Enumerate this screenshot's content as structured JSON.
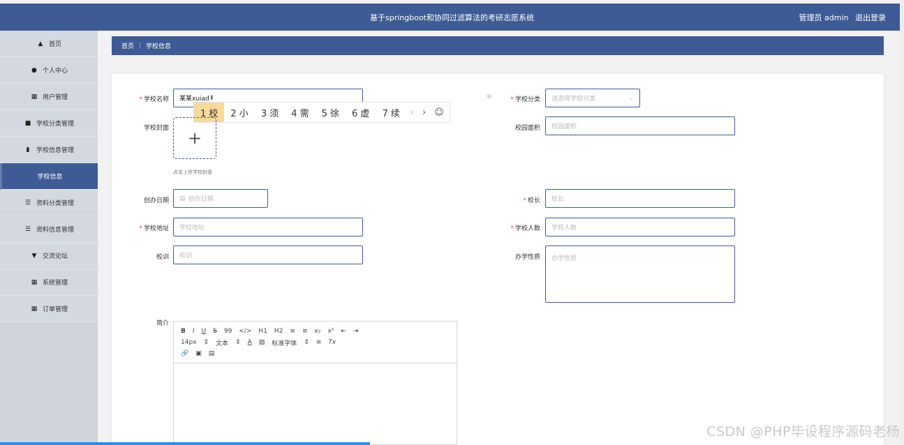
{
  "header": {
    "title": "基于springboot和协同过滤算法的考研志愿系统",
    "user": "管理员 admin",
    "logout": "退出登录"
  },
  "sidebar": {
    "items": [
      {
        "label": "首页",
        "icon": "home-icon"
      },
      {
        "label": "个人中心",
        "icon": "user-icon"
      },
      {
        "label": "用户管理",
        "icon": "grid-icon"
      },
      {
        "label": "学校分类管理",
        "icon": "ticket-icon"
      },
      {
        "label": "学校信息管理",
        "icon": "file-icon"
      },
      {
        "label": "学校信息",
        "icon": ""
      },
      {
        "label": "资料分类管理",
        "icon": "list-icon"
      },
      {
        "label": "资料信息管理",
        "icon": "list-icon"
      },
      {
        "label": "交流论坛",
        "icon": "forum-icon"
      },
      {
        "label": "系统管理",
        "icon": "grid-icon"
      },
      {
        "label": "订单管理",
        "icon": "grid-icon"
      }
    ]
  },
  "breadcrumb": {
    "home": "首页",
    "sep": "⋮",
    "current": "学校信息"
  },
  "form": {
    "name_label": "学校名称",
    "name_value": "某某xuiad",
    "category_label": "学校分类",
    "category_placeholder": "请选择学校分类",
    "cover_label": "学校封面",
    "cover_hint": "点击上传学校封面",
    "area_label": "校园面积",
    "area_placeholder": "校园面积",
    "founded_label": "创办日期",
    "founded_placeholder": "创办日期",
    "president_label": "校长",
    "president_placeholder": "校长",
    "address_label": "学校地址",
    "address_placeholder": "学校地址",
    "students_label": "学校人数",
    "students_placeholder": "学校人数",
    "motto_label": "校训",
    "motto_placeholder": "校训",
    "nature_label": "办学性质",
    "nature_placeholder": "办学性质",
    "intro_label": "简介"
  },
  "ime": {
    "candidates": [
      "1 校",
      "2 小",
      "3 须",
      "4 需",
      "5 徐",
      "6 虚",
      "7 续"
    ]
  },
  "editor": {
    "row1": [
      "B",
      "I",
      "U",
      "S",
      "99",
      "</>",
      "H1",
      "H2",
      "≡",
      "≡",
      "x₂",
      "x²",
      "⇤",
      "⇥"
    ],
    "row2": [
      "14px",
      "⇕",
      "文本",
      "⇕",
      "A",
      "▨",
      "标准字体",
      "⇕",
      "≡",
      "Tx"
    ],
    "row3": [
      "🔗",
      "▣",
      "▤"
    ]
  },
  "watermark": "CSDN @PHP毕设程序源码老杨"
}
